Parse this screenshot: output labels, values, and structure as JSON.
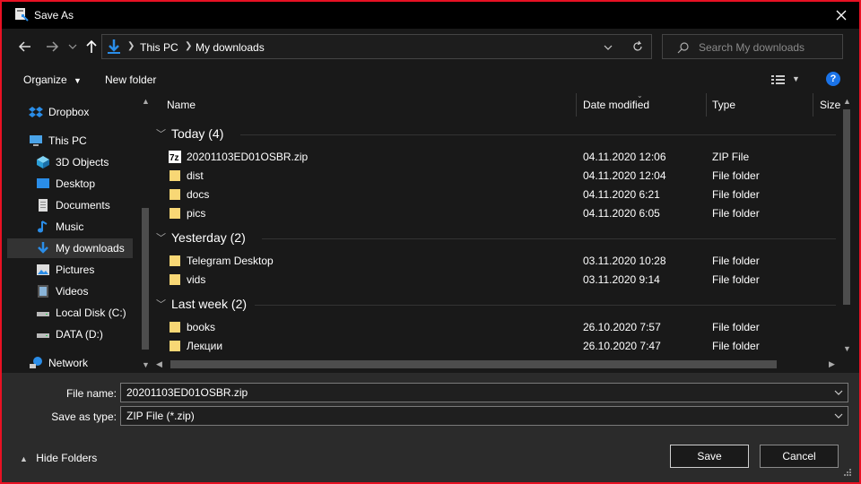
{
  "window": {
    "title": "Save As"
  },
  "address": {
    "crumbs": [
      "This PC",
      "My downloads"
    ]
  },
  "search": {
    "placeholder": "Search My downloads"
  },
  "commands": {
    "organize": "Organize",
    "new_folder": "New folder",
    "help": "?"
  },
  "sidebar": {
    "items": [
      {
        "label": "Dropbox",
        "icon": "dropbox-icon"
      },
      {
        "label": "This PC",
        "icon": "computer-icon"
      },
      {
        "label": "3D Objects",
        "icon": "cube-icon"
      },
      {
        "label": "Desktop",
        "icon": "desktop-icon"
      },
      {
        "label": "Documents",
        "icon": "document-icon"
      },
      {
        "label": "Music",
        "icon": "music-icon"
      },
      {
        "label": "My downloads",
        "icon": "download-icon",
        "selected": true
      },
      {
        "label": "Pictures",
        "icon": "pictures-icon"
      },
      {
        "label": "Videos",
        "icon": "videos-icon"
      },
      {
        "label": "Local Disk (C:)",
        "icon": "drive-icon"
      },
      {
        "label": "DATA (D:)",
        "icon": "drive-icon"
      },
      {
        "label": "Network",
        "icon": "network-icon"
      }
    ]
  },
  "columns": {
    "name": "Name",
    "date": "Date modified",
    "type": "Type",
    "size": "Size"
  },
  "groups": [
    {
      "label": "Today (4)",
      "files": [
        {
          "name": "20201103ED01OSBR.zip",
          "date": "04.11.2020 12:06",
          "type": "ZIP File",
          "icon": "zip-icon"
        },
        {
          "name": "dist",
          "date": "04.11.2020 12:04",
          "type": "File folder",
          "icon": "folder-icon"
        },
        {
          "name": "docs",
          "date": "04.11.2020 6:21",
          "type": "File folder",
          "icon": "folder-icon"
        },
        {
          "name": "pics",
          "date": "04.11.2020 6:05",
          "type": "File folder",
          "icon": "folder-icon"
        }
      ]
    },
    {
      "label": "Yesterday (2)",
      "files": [
        {
          "name": "Telegram Desktop",
          "date": "03.11.2020 10:28",
          "type": "File folder",
          "icon": "folder-icon"
        },
        {
          "name": "vids",
          "date": "03.11.2020 9:14",
          "type": "File folder",
          "icon": "folder-icon"
        }
      ]
    },
    {
      "label": "Last week (2)",
      "files": [
        {
          "name": "books",
          "date": "26.10.2020 7:57",
          "type": "File folder",
          "icon": "folder-icon"
        },
        {
          "name": "Лекции",
          "date": "26.10.2020 7:47",
          "type": "File folder",
          "icon": "folder-icon"
        }
      ]
    }
  ],
  "form": {
    "file_name_label": "File name:",
    "file_name_value": "20201103ED01OSBR.zip",
    "type_label": "Save as type:",
    "type_value": "ZIP File (*.zip)"
  },
  "footer": {
    "hide_folders": "Hide Folders",
    "save": "Save",
    "cancel": "Cancel"
  },
  "colors": {
    "accent": "#e81123",
    "folder": "#f8d775",
    "selection": "#333333",
    "help": "#1a73e8"
  }
}
